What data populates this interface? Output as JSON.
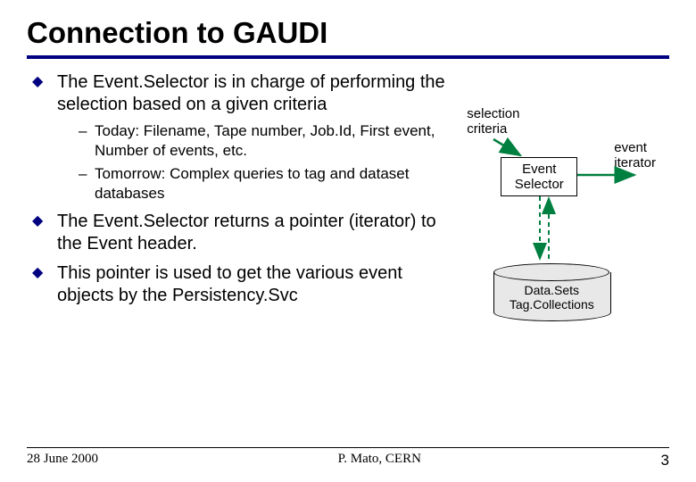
{
  "title": "Connection to GAUDI",
  "bullets": {
    "b1": "The Event.Selector is in charge of performing the selection based on a given criteria",
    "b1_sub1": "Today: Filename, Tape number, Job.Id, First event, Number of events, etc.",
    "b1_sub2": "Tomorrow: Complex queries to tag and dataset databases",
    "b2": "The Event.Selector returns a pointer (iterator) to the Event header.",
    "b3": "This pointer is used to get the various event objects by the Persistency.Svc"
  },
  "diagram": {
    "selection_criteria": "selection criteria",
    "event_iterator": "event iterator",
    "event_selector_box": "Event Selector",
    "cylinder_line1": "Data.Sets",
    "cylinder_line2": "Tag.Collections"
  },
  "footer": {
    "date": "28 June 2000",
    "author": "P. Mato, CERN",
    "page": "3"
  }
}
